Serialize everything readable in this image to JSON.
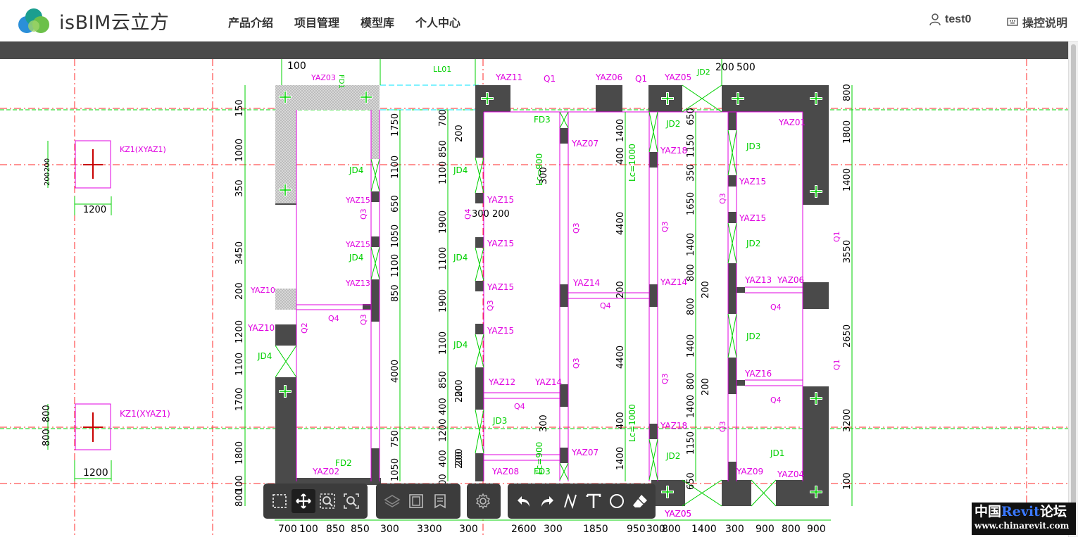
{
  "app": {
    "brand": "isBIM云立方",
    "nav": [
      "产品介绍",
      "项目管理",
      "模型库",
      "个人中心"
    ],
    "user": "test0",
    "help": "操控说明",
    "brand_colors": [
      "#2b8fd8",
      "#6cc04a",
      "#1b9e8f"
    ]
  },
  "drawing": {
    "top_labels": [
      "100",
      "YAZ03",
      "FD1",
      "LL01",
      "YAZ11",
      "Q1",
      "YAZ06",
      "Q1",
      "YAZ05",
      "JD2",
      "200",
      "500"
    ],
    "left_labels": [
      {
        "t": "KZ1(XYAZ1)"
      },
      {
        "t": "1200"
      },
      {
        "t": "KZ1(XYAZ1)"
      },
      {
        "t": "1200"
      },
      {
        "t": "800"
      },
      {
        "t": "800"
      },
      {
        "t": "200"
      },
      {
        "t": "200"
      }
    ],
    "magenta_tags": [
      "YAZ15",
      "YAZ15",
      "YAZ13",
      "YAZ10",
      "YAZ10",
      "YAZ02",
      "YAZ15",
      "YAZ15",
      "YAZ15",
      "YAZ15",
      "YAZ12",
      "YAZ14",
      "YAZ08",
      "YAZ07",
      "YAZ14",
      "YAZ07",
      "YAZ18",
      "YAZ14",
      "YAZ18",
      "YAZ01",
      "YAZ15",
      "YAZ15",
      "YAZ13",
      "YAZ06",
      "YAZ16",
      "YAZ09",
      "YAZ04",
      "YAZ05",
      "Q3",
      "Q3",
      "Q4",
      "Q2",
      "Q4",
      "Q3",
      "Q3",
      "Q3",
      "Q3",
      "Q4",
      "Q3",
      "Q4",
      "Q3",
      "Q4",
      "Q1",
      "Q1",
      "Q4",
      "Q3"
    ],
    "green_tags": [
      "JD4",
      "JD4",
      "JD4",
      "JD4",
      "JD4",
      "JD4",
      "JD3",
      "FD3",
      "FD3",
      "FD2",
      "JD2",
      "JD3",
      "JD2",
      "JD2",
      "JD2",
      "JD1",
      "Lc=900",
      "Lc=1000",
      "Lc=900",
      "Lc=1000"
    ],
    "vertical_dims": [
      "1750",
      "1100",
      "650",
      "1050",
      "1100",
      "850",
      "4000",
      "750",
      "1050",
      "700",
      "850",
      "1100",
      "1900",
      "1100",
      "1900",
      "1100",
      "850",
      "400",
      "1200",
      "400",
      "600",
      "1400",
      "400",
      "4400",
      "200",
      "4400",
      "400",
      "1400",
      "650",
      "1150",
      "350",
      "1650",
      "1400",
      "800",
      "800",
      "1400",
      "800",
      "1400",
      "1150",
      "650",
      "800",
      "1800",
      "1400",
      "3550",
      "2650",
      "3200",
      "100",
      "300",
      "300",
      "200",
      "200",
      "200",
      "200",
      "200",
      "200",
      "200"
    ],
    "left_vdims": [
      "150",
      "1000",
      "350",
      "3450",
      "200",
      "1200",
      "1100",
      "1700",
      "1800",
      "100",
      "800"
    ],
    "bottom_dims": [
      "700",
      "100",
      "850",
      "850",
      "300",
      "3300",
      "300",
      "2600",
      "300",
      "1850",
      "950",
      "300",
      "800",
      "1400",
      "300",
      "900",
      "800",
      "900"
    ],
    "bottom_tag": "YAZ05",
    "mid_text": "300 200",
    "right_labels": [
      "800",
      "100",
      "1800",
      "1400",
      "3550",
      "2650",
      "3200",
      "100",
      "800"
    ],
    "colors": {
      "green": "#00d000",
      "red": "#ff2a2a",
      "magenta": "#e000e0",
      "wall": "#4a4a4a",
      "cyan": "#00ffff"
    }
  },
  "toolbar": {
    "group1": [
      "box-select-icon",
      "move-icon",
      "zoom-window-icon",
      "zoom-extent-icon"
    ],
    "group2": [
      "layers-icon",
      "frame-icon",
      "properties-icon"
    ],
    "group3": [
      "settings-icon"
    ],
    "group4": [
      "undo-icon",
      "redo-icon",
      "freehand-icon",
      "text-icon",
      "circle-icon",
      "eraser-icon"
    ]
  },
  "watermark": {
    "cn1": "中国",
    "rv": "Revit",
    "cn2": "论坛",
    "url": "www.chinarevit.com"
  }
}
